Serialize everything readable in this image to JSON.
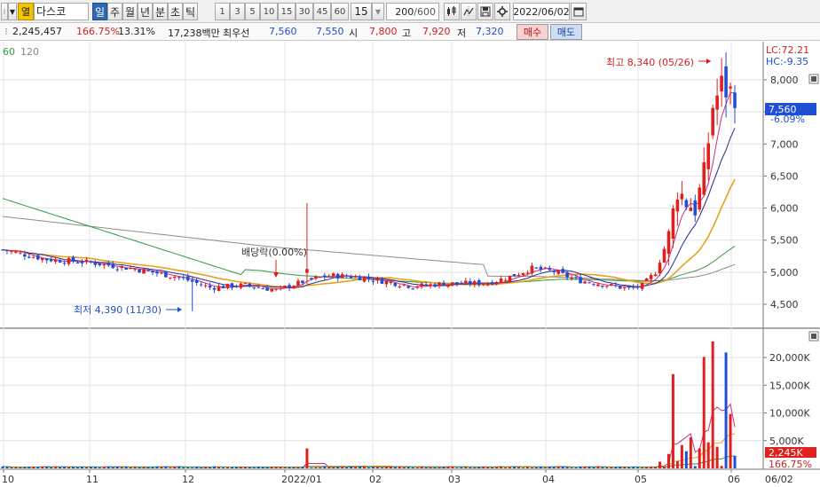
{
  "toolbar": {
    "market_badge": "열",
    "stock_name": "다스코",
    "periods": [
      "일",
      "주",
      "월",
      "년",
      "분",
      "초",
      "틱"
    ],
    "active_period": "일",
    "intervals": [
      "1",
      "3",
      "5",
      "10",
      "15",
      "30",
      "45",
      "60"
    ],
    "interval_value": "15",
    "bar_count": "200",
    "bar_total": "/600",
    "date": "2022/06/02"
  },
  "info": {
    "volume": "2,245,457",
    "volume_ratio": "166.75%",
    "turnover": "13.31%",
    "amount": "17,238백만",
    "best_bid_label": "최우선",
    "best_ask": "7,560",
    "best_bid": "7,550",
    "open_label": "시",
    "open": "7,800",
    "high_label": "고",
    "high": "7,920",
    "low_label": "저",
    "low": "7,320",
    "buy_label": "매수",
    "sell_label": "매도"
  },
  "legend": {
    "ma60": "60",
    "ma120": "120"
  },
  "price_panel": {
    "lc": "LC:72.21",
    "hc": "HC:-9.35",
    "current_price": "7,560",
    "change_pct": "-6.09%",
    "high_annotation": "최고 8,340 (05/26)",
    "low_annotation": "최저 4,390 (11/30)",
    "dividend_annotation": "배당락(0.00%)"
  },
  "volume_panel": {
    "current_volume": "2,245K",
    "volume_pct": "166.75%"
  },
  "colors": {
    "up": "#e0201c",
    "down": "#1f4fd6",
    "ma5": "#d22c7e",
    "ma10": "#2a2a8c",
    "ma20": "#e6a21a",
    "ma60": "#2e9a3e",
    "ma120": "#8c8c8c"
  },
  "chart_data": [
    {
      "type": "candlestick",
      "y_ticks": [
        "4,500",
        "5,000",
        "5,500",
        "6,000",
        "6,500",
        "7,000",
        "7,500",
        "8,000"
      ],
      "ylim": [
        4200,
        8500
      ],
      "x_ticks": [
        "10",
        "11",
        "12",
        "2022/01",
        "02",
        "03",
        "04",
        "05",
        "06",
        "06/02"
      ],
      "key_points": [
        {
          "date": "2021/11/30",
          "low": 4390
        },
        {
          "date": "2022/05/26",
          "high": 8340
        },
        {
          "date": "2022/06/02",
          "open": 7800,
          "high": 7920,
          "low": 7320,
          "close": 7560
        }
      ]
    },
    {
      "type": "bar",
      "y_ticks": [
        "5,000K",
        "10,000K",
        "15,000K",
        "20,000K"
      ],
      "ylim": [
        0,
        23000
      ],
      "latest_value_k": 2245
    }
  ]
}
